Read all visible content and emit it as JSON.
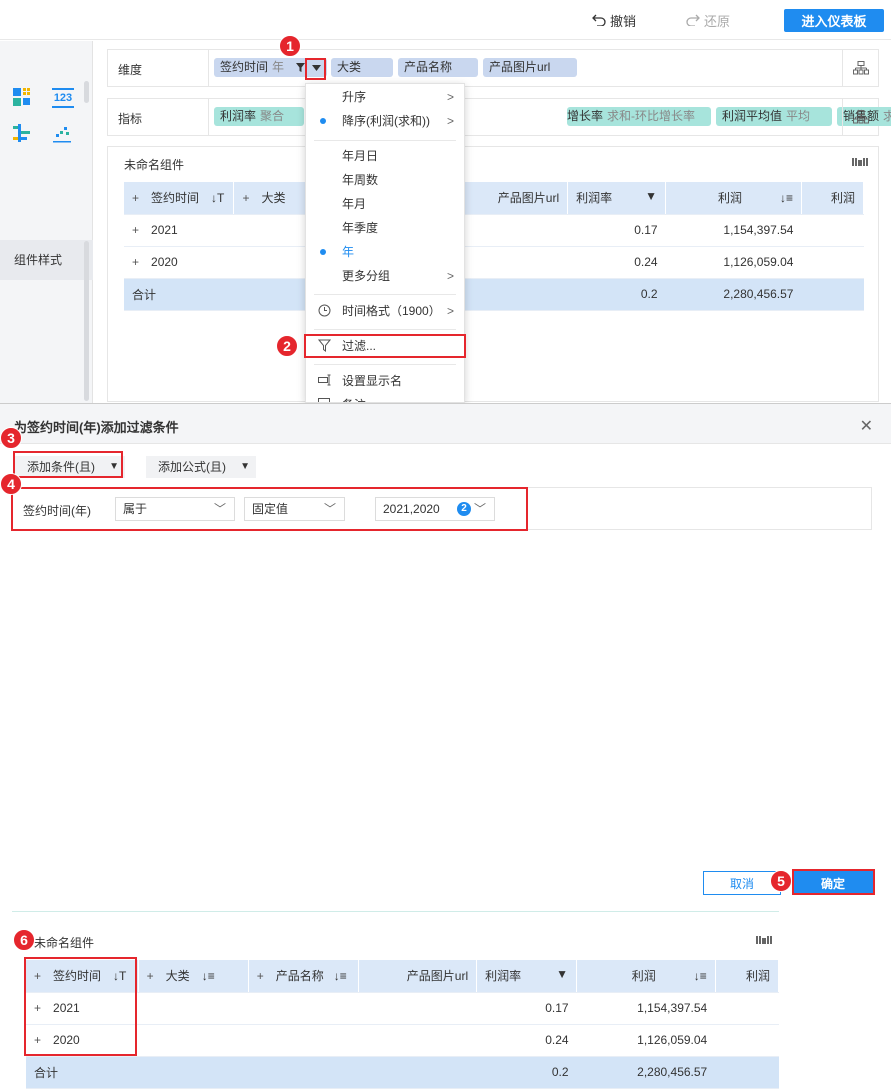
{
  "topbar": {
    "undo_label": "撤销",
    "redo_label": "还原",
    "enter_dashboard_label": "进入仪表板"
  },
  "left_panel": {
    "component_style_tab": "组件样式",
    "chart_icons": [
      "grid-table-icon",
      "number-kpi-icon",
      "bar-group-icon",
      "scatter-icon"
    ],
    "kpi_icon_text": "123"
  },
  "dimension_row": {
    "label": "维度",
    "chips": [
      {
        "name": "签约时间",
        "sub": "年"
      },
      {
        "name": "大类"
      },
      {
        "name": "产品名称"
      },
      {
        "name": "产品图片url"
      }
    ]
  },
  "metric_row": {
    "label": "指标",
    "chips": [
      {
        "name": "利润率",
        "sub": "聚合"
      },
      {
        "name": "增长率",
        "sub": "求和-环比增长率"
      },
      {
        "name": "利润平均值",
        "sub": "平均"
      },
      {
        "name": "销售额",
        "sub": "求和"
      }
    ]
  },
  "component": {
    "title": "未命名组件",
    "headers": [
      "签约时间",
      "大类",
      "产品图片url",
      "利润率",
      "利润",
      "利润"
    ],
    "rows": [
      {
        "year": "2021",
        "rate": "0.17",
        "profit": "1,154,397.54"
      },
      {
        "year": "2020",
        "rate": "0.24",
        "profit": "1,126,059.04"
      }
    ],
    "total": {
      "label": "合计",
      "rate": "0.2",
      "profit": "2,280,456.57"
    }
  },
  "dropdown": {
    "items": [
      {
        "label": "升序",
        "submenu": true
      },
      {
        "label": "降序(利润(求和))",
        "submenu": true,
        "selected": true
      },
      {
        "label": "年月日"
      },
      {
        "label": "年周数"
      },
      {
        "label": "年月"
      },
      {
        "label": "年季度"
      },
      {
        "label": "年",
        "selected": true
      },
      {
        "label": "更多分组",
        "submenu": true
      },
      {
        "label": "时间格式（1900）",
        "submenu": true
      },
      {
        "label": "过滤..."
      },
      {
        "label": "设置显示名"
      },
      {
        "label": "备注"
      }
    ]
  },
  "dialog": {
    "title": "为签约时间(年)添加过滤条件",
    "add_condition": "添加条件(且)",
    "add_formula": "添加公式(且)",
    "condition": {
      "field": "签约时间(年)",
      "operator": "属于",
      "value_type": "固定值",
      "values": "2021,2020",
      "count": "2"
    },
    "cancel_label": "取消",
    "ok_label": "确定"
  },
  "preview": {
    "title": "未命名组件",
    "headers": [
      "签约时间",
      "大类",
      "产品名称",
      "产品图片url",
      "利润率",
      "利润",
      "利润"
    ],
    "rows": [
      {
        "year": "2021",
        "rate": "0.17",
        "profit": "1,154,397.54"
      },
      {
        "year": "2020",
        "rate": "0.24",
        "profit": "1,126,059.04"
      }
    ],
    "total": {
      "label": "合计",
      "rate": "0.2",
      "profit": "2,280,456.57"
    }
  },
  "annotations": [
    "1",
    "2",
    "3",
    "4",
    "5",
    "6"
  ],
  "colors": {
    "accent": "#1f8cf0",
    "annotation_red": "#e5262d",
    "dimension_chip": "#c9d7ef",
    "metric_chip": "#a7e4dc",
    "table_header": "#dbe8f8"
  }
}
